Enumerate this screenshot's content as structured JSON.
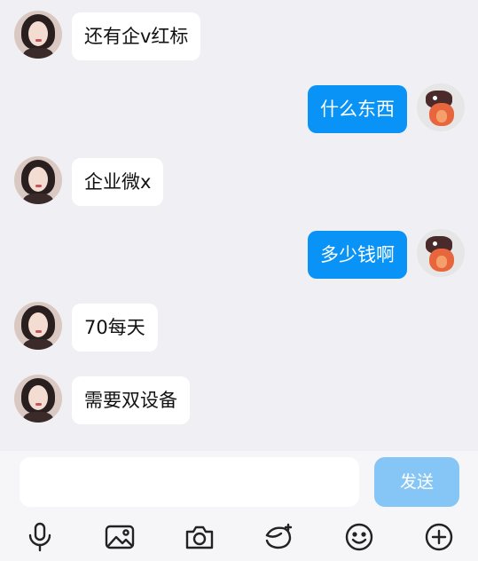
{
  "messages": [
    {
      "side": "left",
      "text": "还有企v红标"
    },
    {
      "side": "right",
      "text": "什么东西"
    },
    {
      "side": "left",
      "text": "企业微x"
    },
    {
      "side": "right",
      "text": "多少钱啊"
    },
    {
      "side": "left",
      "text": "70每天"
    },
    {
      "side": "left",
      "text": "需要双设备"
    }
  ],
  "input": {
    "placeholder": "",
    "value": "",
    "send_label": "发送"
  },
  "toolbar": {
    "icons": [
      "microphone-icon",
      "image-icon",
      "camera-icon",
      "red-packet-icon",
      "emoji-icon",
      "plus-icon"
    ]
  },
  "colors": {
    "background": "#efeff4",
    "bubble_self": "#0a93f6",
    "bubble_other": "#ffffff",
    "send_disabled": "#86c6f6"
  }
}
